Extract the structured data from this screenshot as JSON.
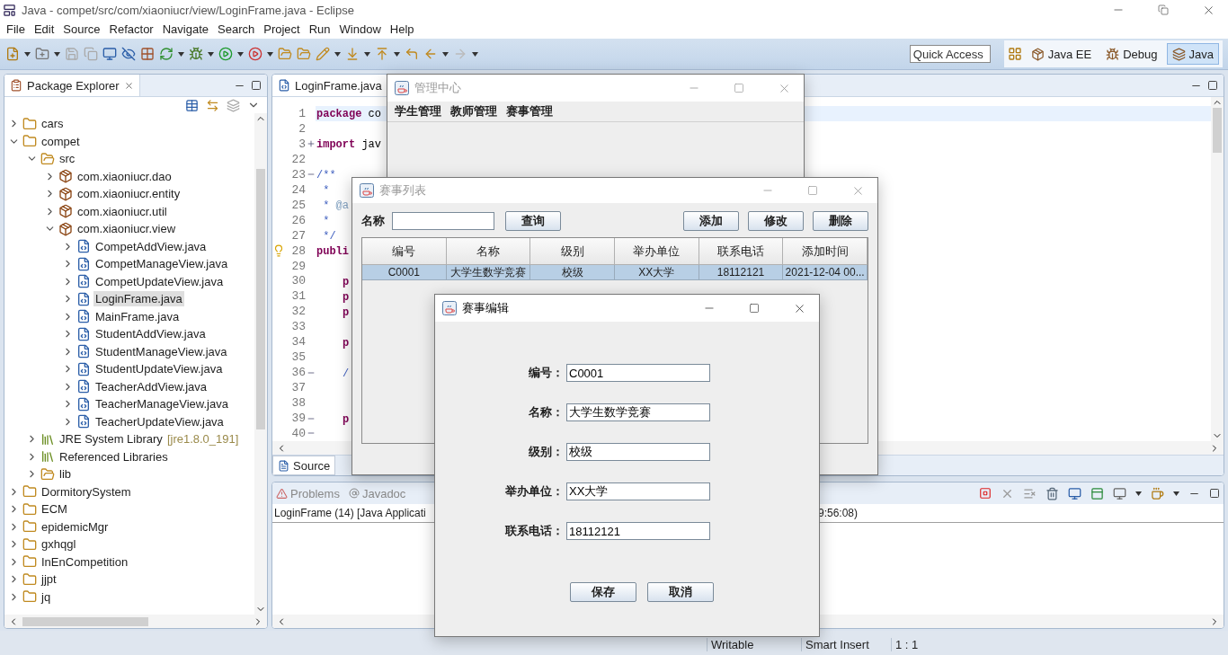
{
  "window": {
    "title": "Java - compet/src/com/xiaoniucr/view/LoginFrame.java - Eclipse"
  },
  "menu": [
    "File",
    "Edit",
    "Source",
    "Refactor",
    "Navigate",
    "Search",
    "Project",
    "Run",
    "Window",
    "Help"
  ],
  "quick_access": {
    "placeholder": "Quick Access"
  },
  "perspectives": [
    {
      "label": "Java EE",
      "selected": false
    },
    {
      "label": "Debug",
      "selected": false
    },
    {
      "label": "Java",
      "selected": true
    }
  ],
  "package_explorer": {
    "title": "Package Explorer",
    "tree": [
      {
        "kind": "project",
        "label": "cars",
        "expanded": false,
        "selected": false
      },
      {
        "kind": "project",
        "label": "compet",
        "expanded": true,
        "selected": false,
        "children": [
          {
            "kind": "source-folder",
            "label": "src",
            "expanded": true,
            "selected": false,
            "children": [
              {
                "kind": "package",
                "label": "com.xiaoniucr.dao",
                "expanded": false,
                "selected": false
              },
              {
                "kind": "package",
                "label": "com.xiaoniucr.entity",
                "expanded": false,
                "selected": false
              },
              {
                "kind": "package",
                "label": "com.xiaoniucr.util",
                "expanded": false,
                "selected": false
              },
              {
                "kind": "package",
                "label": "com.xiaoniucr.view",
                "expanded": true,
                "selected": false,
                "children": [
                  {
                    "kind": "file",
                    "label": "CompetAddView.java",
                    "expanded": false,
                    "selected": false
                  },
                  {
                    "kind": "file",
                    "label": "CompetManageView.java",
                    "expanded": false,
                    "selected": false
                  },
                  {
                    "kind": "file",
                    "label": "CompetUpdateView.java",
                    "expanded": false,
                    "selected": false
                  },
                  {
                    "kind": "file",
                    "label": "LoginFrame.java",
                    "expanded": false,
                    "selected": true
                  },
                  {
                    "kind": "file",
                    "label": "MainFrame.java",
                    "expanded": false,
                    "selected": false
                  },
                  {
                    "kind": "file",
                    "label": "StudentAddView.java",
                    "expanded": false,
                    "selected": false
                  },
                  {
                    "kind": "file",
                    "label": "StudentManageView.java",
                    "expanded": false,
                    "selected": false
                  },
                  {
                    "kind": "file",
                    "label": "StudentUpdateView.java",
                    "expanded": false,
                    "selected": false
                  },
                  {
                    "kind": "file",
                    "label": "TeacherAddView.java",
                    "expanded": false,
                    "selected": false
                  },
                  {
                    "kind": "file",
                    "label": "TeacherManageView.java",
                    "expanded": false,
                    "selected": false
                  },
                  {
                    "kind": "file",
                    "label": "TeacherUpdateView.java",
                    "expanded": false,
                    "selected": false
                  }
                ]
              }
            ]
          },
          {
            "kind": "library",
            "label": "JRE System Library",
            "decoration": "[jre1.8.0_191]",
            "expanded": false,
            "selected": false
          },
          {
            "kind": "library",
            "label": "Referenced Libraries",
            "expanded": false,
            "selected": false
          },
          {
            "kind": "folder",
            "label": "lib",
            "expanded": false,
            "selected": false
          }
        ]
      },
      {
        "kind": "project",
        "label": "DormitorySystem",
        "expanded": false,
        "selected": false
      },
      {
        "kind": "project",
        "label": "ECM",
        "expanded": false,
        "selected": false
      },
      {
        "kind": "project",
        "label": "epidemicMgr",
        "expanded": false,
        "selected": false
      },
      {
        "kind": "project",
        "label": "gxhqgl",
        "expanded": false,
        "selected": false
      },
      {
        "kind": "project",
        "label": "InEnCompetition",
        "expanded": false,
        "selected": false
      },
      {
        "kind": "project",
        "label": "jjpt",
        "expanded": false,
        "selected": false
      },
      {
        "kind": "project",
        "label": "jq",
        "expanded": false,
        "selected": false
      }
    ]
  },
  "editor": {
    "tab": "LoginFrame.java",
    "bottom_tabs": [
      {
        "label": "Source",
        "selected": true
      }
    ],
    "lines": [
      {
        "number": "1",
        "current": true,
        "warning": false,
        "indented": false,
        "tokens": [
          {
            "kind": "keyword",
            "text": "package"
          },
          {
            "kind": "plain",
            "text": " co"
          }
        ]
      },
      {
        "number": "2",
        "current": false,
        "warning": false
      },
      {
        "number": "3",
        "current": false,
        "warning": false,
        "indented": false,
        "folded": true,
        "tokens": [
          {
            "kind": "keyword",
            "text": "import"
          },
          {
            "kind": "plain",
            "text": " jav"
          }
        ]
      },
      {
        "number": "22",
        "current": false,
        "warning": false
      },
      {
        "number": "23",
        "current": false,
        "warning": false,
        "indented": false,
        "folded": false,
        "tokens": [
          {
            "kind": "comment",
            "text": "/**"
          }
        ]
      },
      {
        "number": "24",
        "current": false,
        "warning": false,
        "indented": false,
        "tokens": [
          {
            "kind": "comment",
            "text": " *"
          }
        ]
      },
      {
        "number": "25",
        "current": false,
        "warning": false,
        "indented": false,
        "tokens": [
          {
            "kind": "comment",
            "text": " * "
          },
          {
            "kind": "tag",
            "text": "@a"
          }
        ]
      },
      {
        "number": "26",
        "current": false,
        "warning": false,
        "indented": false,
        "tokens": [
          {
            "kind": "comment",
            "text": " *"
          }
        ]
      },
      {
        "number": "27",
        "current": false,
        "warning": false,
        "indented": false,
        "tokens": [
          {
            "kind": "comment",
            "text": " */"
          }
        ]
      },
      {
        "number": "28",
        "current": false,
        "warning": true,
        "indented": false,
        "tokens": [
          {
            "kind": "keyword",
            "text": "publi"
          }
        ]
      },
      {
        "number": "29",
        "current": false,
        "warning": false
      },
      {
        "number": "30",
        "current": false,
        "warning": false,
        "indented": true,
        "tokens": [
          {
            "kind": "keyword",
            "text": "p"
          }
        ]
      },
      {
        "number": "31",
        "current": false,
        "warning": false,
        "indented": true,
        "tokens": [
          {
            "kind": "keyword",
            "text": "p"
          }
        ]
      },
      {
        "number": "32",
        "current": false,
        "warning": false,
        "indented": true,
        "tokens": [
          {
            "kind": "keyword",
            "text": "p"
          }
        ]
      },
      {
        "number": "33",
        "current": false,
        "warning": false
      },
      {
        "number": "34",
        "current": false,
        "warning": false,
        "indented": true,
        "tokens": [
          {
            "kind": "keyword",
            "text": "p"
          }
        ]
      },
      {
        "number": "35",
        "current": false,
        "warning": false
      },
      {
        "number": "36",
        "current": false,
        "warning": false,
        "indented": true,
        "folded": false,
        "tokens": [
          {
            "kind": "comment",
            "text": "/"
          }
        ]
      },
      {
        "number": "37",
        "current": false,
        "warning": false
      },
      {
        "number": "38",
        "current": false,
        "warning": false
      },
      {
        "number": "39",
        "current": false,
        "warning": false,
        "indented": true,
        "folded": false,
        "tokens": [
          {
            "kind": "keyword",
            "text": "p"
          }
        ]
      },
      {
        "number": "40",
        "current": false,
        "warning": false,
        "folded": false
      }
    ]
  },
  "console": {
    "tabs": [
      "Problems",
      "Javadoc"
    ],
    "header": "LoginFrame (14) [Java Applicati",
    "header_tail": "9:56:08)"
  },
  "status_bar": [
    "Writable",
    "Smart Insert",
    "1 : 1"
  ],
  "app_windows": [
    {
      "kind": "menu-frame",
      "title": "管理中心",
      "active": false,
      "menu": [
        "学生管理",
        "教师管理",
        "赛事管理"
      ]
    },
    {
      "kind": "list-frame",
      "title": "赛事列表",
      "active": false,
      "search_label": "名称",
      "search_button": "查询",
      "actions": [
        "添加",
        "修改",
        "删除"
      ],
      "table": {
        "columns": [
          "编号",
          "名称",
          "级别",
          "举办单位",
          "联系电话",
          "添加时间"
        ],
        "rows": [
          {
            "selected": true,
            "cells": [
              "C0001",
              "大学生数学竞赛",
              "校级",
              "XX大学",
              "18112121",
              "2021-12-04 00..."
            ]
          }
        ]
      }
    },
    {
      "kind": "edit-frame",
      "title": "赛事编辑",
      "active": true,
      "fields": [
        {
          "label": "编号：",
          "value": "C0001"
        },
        {
          "label": "名称：",
          "value": "大学生数学竞赛"
        },
        {
          "label": "级别：",
          "value": "校级"
        },
        {
          "label": "举办单位：",
          "value": "XX大学"
        },
        {
          "label": "联系电话：",
          "value": "18112121"
        }
      ],
      "buttons": [
        "保存",
        "取消"
      ]
    }
  ]
}
